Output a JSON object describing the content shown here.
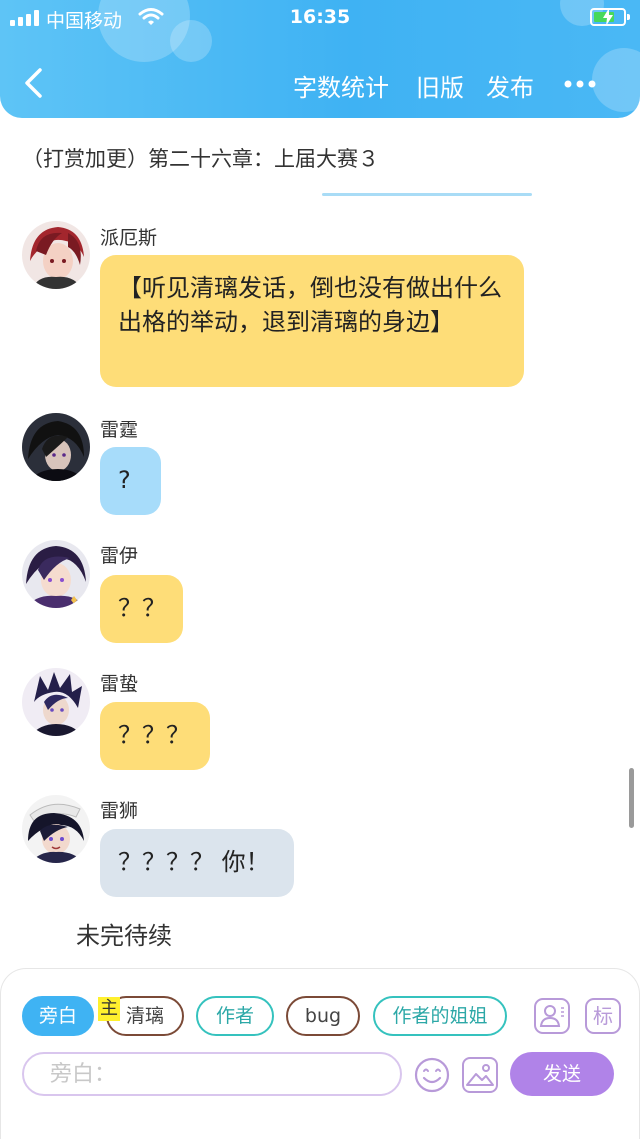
{
  "status_bar": {
    "carrier": "中国移动",
    "time": "16:35"
  },
  "nav": {
    "word_count": "字数统计",
    "old_version": "旧版",
    "publish": "发布"
  },
  "chapter": {
    "title": "（打赏加更）第二十六章：上届大赛３"
  },
  "messages": [
    {
      "name": "派厄斯",
      "text": "【听见清璃发话，倒也没有做出什么出格的举动，退到清璃的身边】",
      "color": "yellow"
    },
    {
      "name": "雷霆",
      "text": "?",
      "color": "blue"
    },
    {
      "name": "雷伊",
      "text": "？？",
      "color": "yellow"
    },
    {
      "name": "雷蛰",
      "text": "？？？",
      "color": "yellow"
    },
    {
      "name": "雷狮",
      "text": "？？？？ 你！",
      "color": "grey"
    }
  ],
  "to_be_continued": "未完待续",
  "chips": {
    "narration": "旁白",
    "host_tag": "主",
    "qingli": "清璃",
    "author": "作者",
    "bug": "bug",
    "author_sister": "作者的姐姐",
    "mark": "标"
  },
  "input": {
    "placeholder": "旁白："
  },
  "send_label": "发送",
  "colors": {
    "header": "#3fb2f3",
    "bubble_yellow": "#fedd78",
    "bubble_blue": "#a7dcfa",
    "bubble_grey": "#dbe4ed",
    "send_button": "#b083e8",
    "chip_teal": "#35c2be",
    "chip_brown": "#7b4a37"
  }
}
